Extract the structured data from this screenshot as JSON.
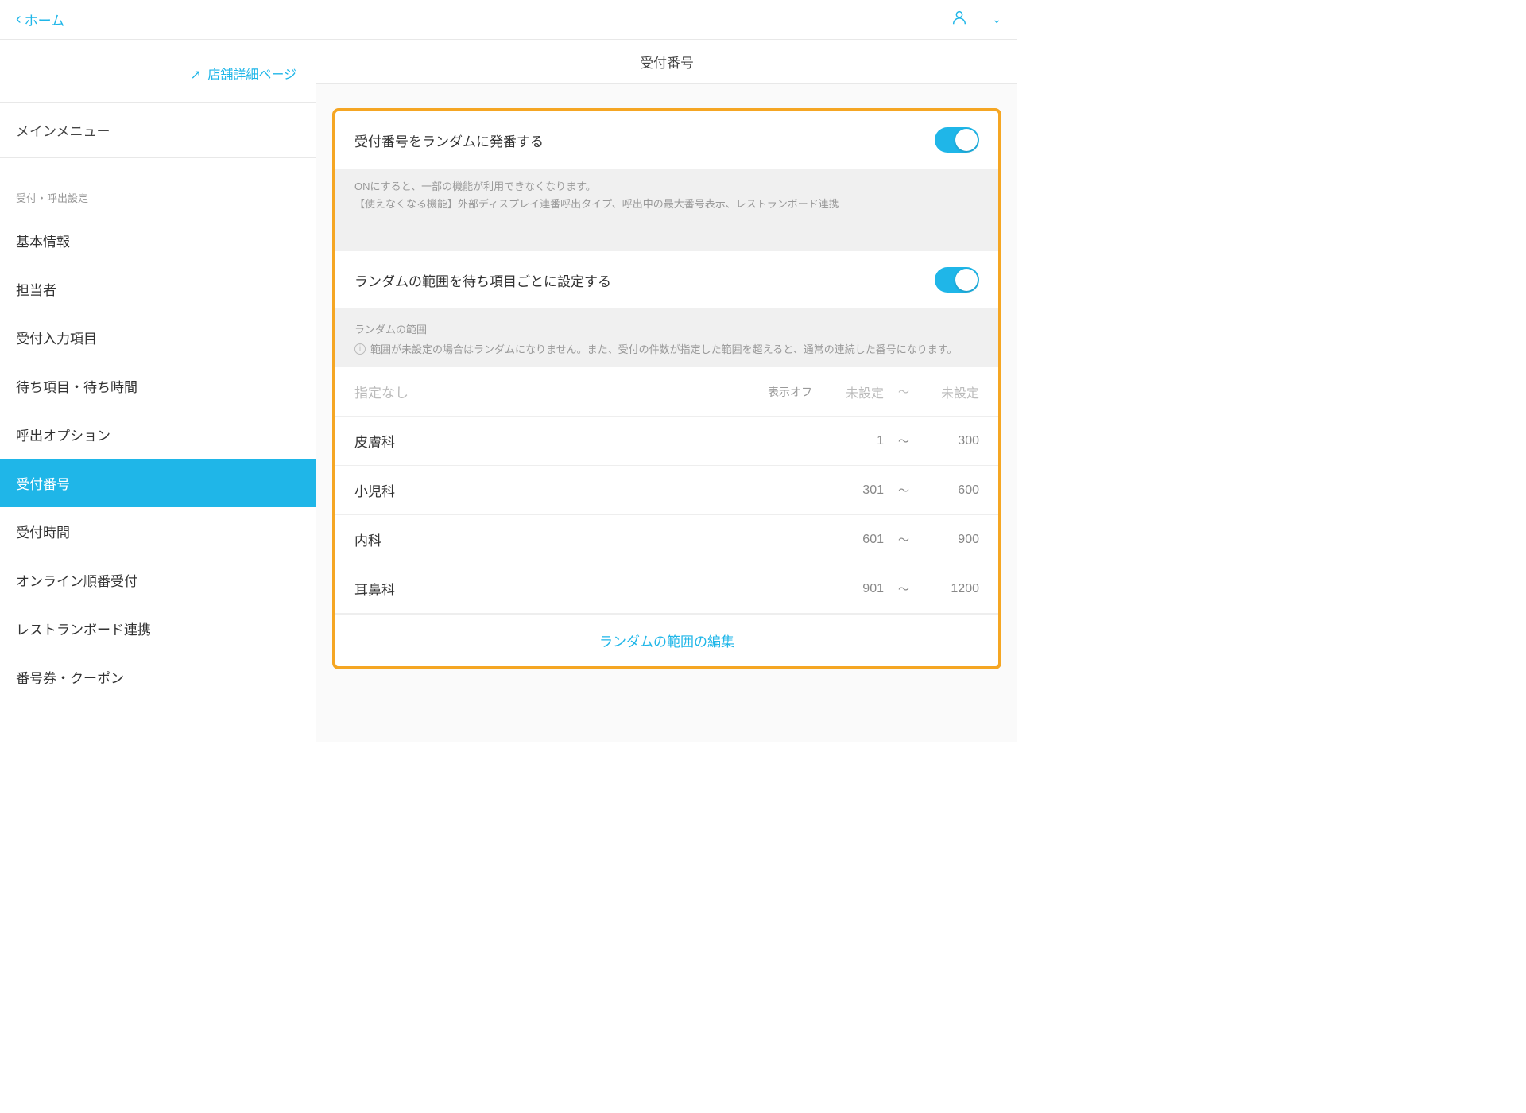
{
  "topbar": {
    "back_label": "ホーム"
  },
  "sidebar": {
    "shop_detail_link": "店舗詳細ページ",
    "main_menu_label": "メインメニュー",
    "section_label": "受付・呼出設定",
    "items": [
      {
        "label": "基本情報"
      },
      {
        "label": "担当者"
      },
      {
        "label": "受付入力項目"
      },
      {
        "label": "待ち項目・待ち時間"
      },
      {
        "label": "呼出オプション"
      },
      {
        "label": "受付番号"
      },
      {
        "label": "受付時間"
      },
      {
        "label": "オンライン順番受付"
      },
      {
        "label": "レストランボード連携"
      },
      {
        "label": "番号券・クーポン"
      }
    ]
  },
  "content": {
    "title": "受付番号",
    "random_issue": {
      "label": "受付番号をランダムに発番する",
      "on": true,
      "desc_line1": "ONにすると、一部の機能が利用できなくなります。",
      "desc_line2": "【使えなくなる機能】外部ディスプレイ連番呼出タイプ、呼出中の最大番号表示、レストランボード連携"
    },
    "per_item_range": {
      "label": "ランダムの範囲を待ち項目ごとに設定する",
      "on": true
    },
    "range_section": {
      "header": "ランダムの範囲",
      "note": "範囲が未設定の場合はランダムになりません。また、受付の件数が指定した範囲を超えると、通常の連続した番号になります。",
      "off_label": "表示オフ",
      "unset_label": "未設定",
      "rows": [
        {
          "name": "指定なし",
          "disabled": true,
          "display_off": true,
          "min": null,
          "max": null
        },
        {
          "name": "皮膚科",
          "min": "1",
          "max": "300"
        },
        {
          "name": "小児科",
          "min": "301",
          "max": "600"
        },
        {
          "name": "内科",
          "min": "601",
          "max": "900"
        },
        {
          "name": "耳鼻科",
          "min": "901",
          "max": "1200"
        }
      ],
      "edit_link": "ランダムの範囲の編集"
    }
  }
}
